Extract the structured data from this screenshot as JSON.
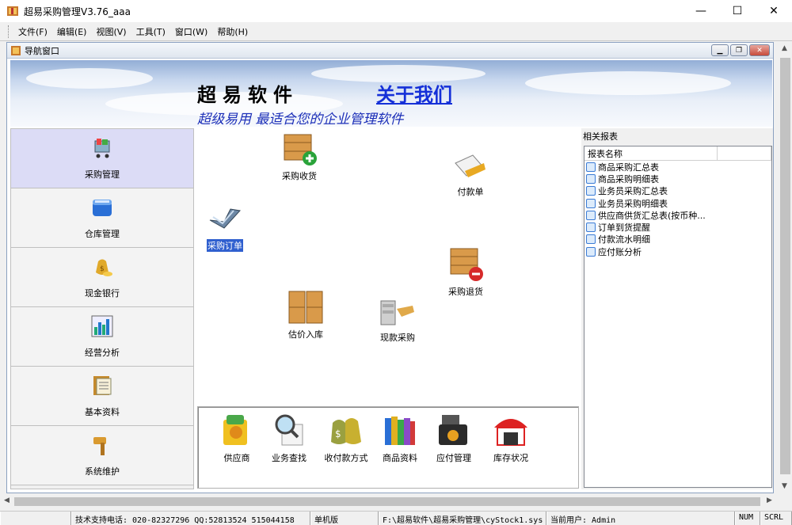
{
  "window": {
    "title": "超易采购管理V3.76_aaa"
  },
  "menu": [
    "文件(F)",
    "编辑(E)",
    "视图(V)",
    "工具(T)",
    "窗口(W)",
    "帮助(H)"
  ],
  "mdi": {
    "title": "导航窗口"
  },
  "banner": {
    "brand": "超易软件",
    "about": "关于我们",
    "slogan": "超级易用 最适合您的企业管理软件"
  },
  "nav": [
    {
      "label": "采购管理",
      "icon": "cart-icon",
      "active": true
    },
    {
      "label": "仓库管理",
      "icon": "warehouse-box-icon"
    },
    {
      "label": "现金银行",
      "icon": "money-bag-icon"
    },
    {
      "label": "经营分析",
      "icon": "bar-chart-icon"
    },
    {
      "label": "基本资料",
      "icon": "document-folder-icon"
    },
    {
      "label": "系统维护",
      "icon": "hammer-icon"
    }
  ],
  "main_items": {
    "receive": "采购收货",
    "payment": "付款单",
    "order": "采购订单",
    "returns": "采购退货",
    "estimate": "估价入库",
    "cash_purchase": "现款采购"
  },
  "quick": [
    {
      "label": "供应商",
      "icon": "supplier-icon"
    },
    {
      "label": "业务查找",
      "icon": "magnifier-icon"
    },
    {
      "label": "收付款方式",
      "icon": "money-bags-icon"
    },
    {
      "label": "商品资料",
      "icon": "books-icon"
    },
    {
      "label": "应付管理",
      "icon": "cash-register-icon"
    },
    {
      "label": "库存状况",
      "icon": "warehouse-icon"
    }
  ],
  "reports": {
    "title": "相关报表",
    "column": "报表名称",
    "items": [
      "商品采购汇总表",
      "商品采购明细表",
      "业务员采购汇总表",
      "业务员采购明细表",
      "供应商供货汇总表(按币种...",
      "订单到货提醒",
      "付款流水明细",
      "应付账分析"
    ]
  },
  "status": {
    "support": "技术支持电话: 020-82327296 QQ:52813524 515044158",
    "edition": "单机版",
    "path": "F:\\超易软件\\超易采购管理\\cyStock1.sys",
    "user": "当前用户: Admin",
    "num": "NUM",
    "scrl": "SCRL"
  }
}
